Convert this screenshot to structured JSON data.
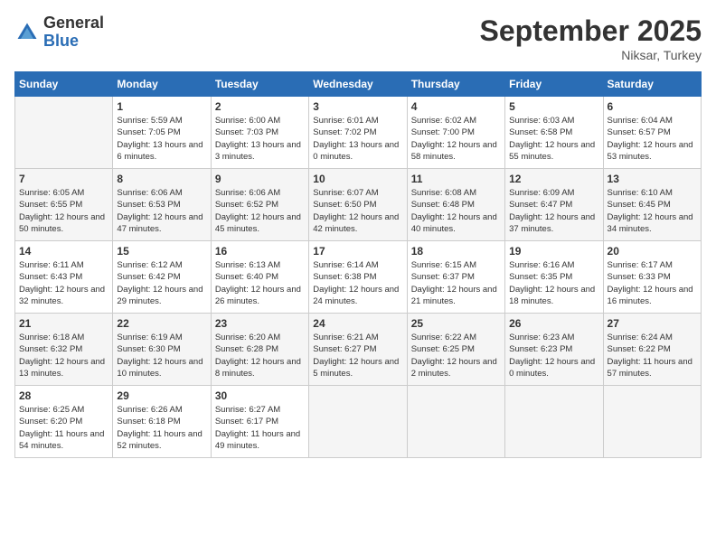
{
  "header": {
    "logo_general": "General",
    "logo_blue": "Blue",
    "month": "September 2025",
    "location": "Niksar, Turkey"
  },
  "days": [
    "Sunday",
    "Monday",
    "Tuesday",
    "Wednesday",
    "Thursday",
    "Friday",
    "Saturday"
  ],
  "weeks": [
    [
      {
        "date": "",
        "sunrise": "",
        "sunset": "",
        "daylight": ""
      },
      {
        "date": "1",
        "sunrise": "Sunrise: 5:59 AM",
        "sunset": "Sunset: 7:05 PM",
        "daylight": "Daylight: 13 hours and 6 minutes."
      },
      {
        "date": "2",
        "sunrise": "Sunrise: 6:00 AM",
        "sunset": "Sunset: 7:03 PM",
        "daylight": "Daylight: 13 hours and 3 minutes."
      },
      {
        "date": "3",
        "sunrise": "Sunrise: 6:01 AM",
        "sunset": "Sunset: 7:02 PM",
        "daylight": "Daylight: 13 hours and 0 minutes."
      },
      {
        "date": "4",
        "sunrise": "Sunrise: 6:02 AM",
        "sunset": "Sunset: 7:00 PM",
        "daylight": "Daylight: 12 hours and 58 minutes."
      },
      {
        "date": "5",
        "sunrise": "Sunrise: 6:03 AM",
        "sunset": "Sunset: 6:58 PM",
        "daylight": "Daylight: 12 hours and 55 minutes."
      },
      {
        "date": "6",
        "sunrise": "Sunrise: 6:04 AM",
        "sunset": "Sunset: 6:57 PM",
        "daylight": "Daylight: 12 hours and 53 minutes."
      }
    ],
    [
      {
        "date": "7",
        "sunrise": "Sunrise: 6:05 AM",
        "sunset": "Sunset: 6:55 PM",
        "daylight": "Daylight: 12 hours and 50 minutes."
      },
      {
        "date": "8",
        "sunrise": "Sunrise: 6:06 AM",
        "sunset": "Sunset: 6:53 PM",
        "daylight": "Daylight: 12 hours and 47 minutes."
      },
      {
        "date": "9",
        "sunrise": "Sunrise: 6:06 AM",
        "sunset": "Sunset: 6:52 PM",
        "daylight": "Daylight: 12 hours and 45 minutes."
      },
      {
        "date": "10",
        "sunrise": "Sunrise: 6:07 AM",
        "sunset": "Sunset: 6:50 PM",
        "daylight": "Daylight: 12 hours and 42 minutes."
      },
      {
        "date": "11",
        "sunrise": "Sunrise: 6:08 AM",
        "sunset": "Sunset: 6:48 PM",
        "daylight": "Daylight: 12 hours and 40 minutes."
      },
      {
        "date": "12",
        "sunrise": "Sunrise: 6:09 AM",
        "sunset": "Sunset: 6:47 PM",
        "daylight": "Daylight: 12 hours and 37 minutes."
      },
      {
        "date": "13",
        "sunrise": "Sunrise: 6:10 AM",
        "sunset": "Sunset: 6:45 PM",
        "daylight": "Daylight: 12 hours and 34 minutes."
      }
    ],
    [
      {
        "date": "14",
        "sunrise": "Sunrise: 6:11 AM",
        "sunset": "Sunset: 6:43 PM",
        "daylight": "Daylight: 12 hours and 32 minutes."
      },
      {
        "date": "15",
        "sunrise": "Sunrise: 6:12 AM",
        "sunset": "Sunset: 6:42 PM",
        "daylight": "Daylight: 12 hours and 29 minutes."
      },
      {
        "date": "16",
        "sunrise": "Sunrise: 6:13 AM",
        "sunset": "Sunset: 6:40 PM",
        "daylight": "Daylight: 12 hours and 26 minutes."
      },
      {
        "date": "17",
        "sunrise": "Sunrise: 6:14 AM",
        "sunset": "Sunset: 6:38 PM",
        "daylight": "Daylight: 12 hours and 24 minutes."
      },
      {
        "date": "18",
        "sunrise": "Sunrise: 6:15 AM",
        "sunset": "Sunset: 6:37 PM",
        "daylight": "Daylight: 12 hours and 21 minutes."
      },
      {
        "date": "19",
        "sunrise": "Sunrise: 6:16 AM",
        "sunset": "Sunset: 6:35 PM",
        "daylight": "Daylight: 12 hours and 18 minutes."
      },
      {
        "date": "20",
        "sunrise": "Sunrise: 6:17 AM",
        "sunset": "Sunset: 6:33 PM",
        "daylight": "Daylight: 12 hours and 16 minutes."
      }
    ],
    [
      {
        "date": "21",
        "sunrise": "Sunrise: 6:18 AM",
        "sunset": "Sunset: 6:32 PM",
        "daylight": "Daylight: 12 hours and 13 minutes."
      },
      {
        "date": "22",
        "sunrise": "Sunrise: 6:19 AM",
        "sunset": "Sunset: 6:30 PM",
        "daylight": "Daylight: 12 hours and 10 minutes."
      },
      {
        "date": "23",
        "sunrise": "Sunrise: 6:20 AM",
        "sunset": "Sunset: 6:28 PM",
        "daylight": "Daylight: 12 hours and 8 minutes."
      },
      {
        "date": "24",
        "sunrise": "Sunrise: 6:21 AM",
        "sunset": "Sunset: 6:27 PM",
        "daylight": "Daylight: 12 hours and 5 minutes."
      },
      {
        "date": "25",
        "sunrise": "Sunrise: 6:22 AM",
        "sunset": "Sunset: 6:25 PM",
        "daylight": "Daylight: 12 hours and 2 minutes."
      },
      {
        "date": "26",
        "sunrise": "Sunrise: 6:23 AM",
        "sunset": "Sunset: 6:23 PM",
        "daylight": "Daylight: 12 hours and 0 minutes."
      },
      {
        "date": "27",
        "sunrise": "Sunrise: 6:24 AM",
        "sunset": "Sunset: 6:22 PM",
        "daylight": "Daylight: 11 hours and 57 minutes."
      }
    ],
    [
      {
        "date": "28",
        "sunrise": "Sunrise: 6:25 AM",
        "sunset": "Sunset: 6:20 PM",
        "daylight": "Daylight: 11 hours and 54 minutes."
      },
      {
        "date": "29",
        "sunrise": "Sunrise: 6:26 AM",
        "sunset": "Sunset: 6:18 PM",
        "daylight": "Daylight: 11 hours and 52 minutes."
      },
      {
        "date": "30",
        "sunrise": "Sunrise: 6:27 AM",
        "sunset": "Sunset: 6:17 PM",
        "daylight": "Daylight: 11 hours and 49 minutes."
      },
      {
        "date": "",
        "sunrise": "",
        "sunset": "",
        "daylight": ""
      },
      {
        "date": "",
        "sunrise": "",
        "sunset": "",
        "daylight": ""
      },
      {
        "date": "",
        "sunrise": "",
        "sunset": "",
        "daylight": ""
      },
      {
        "date": "",
        "sunrise": "",
        "sunset": "",
        "daylight": ""
      }
    ]
  ]
}
